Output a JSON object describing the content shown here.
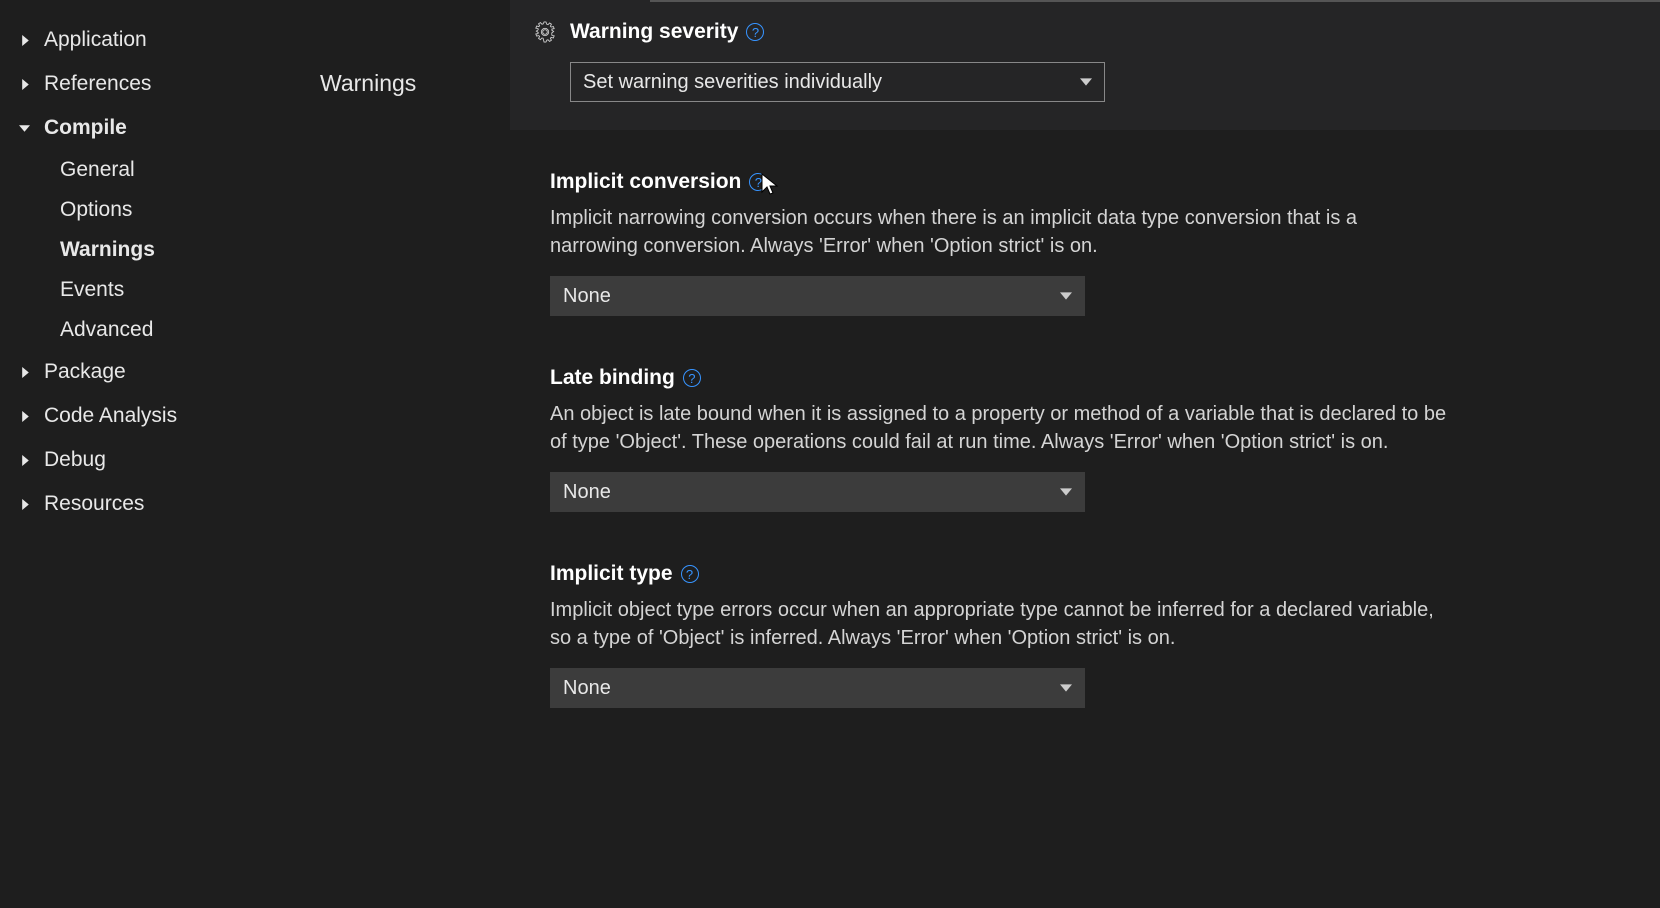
{
  "sidebar": {
    "items": [
      {
        "label": "Application",
        "expanded": false,
        "children": []
      },
      {
        "label": "References",
        "expanded": false,
        "children": []
      },
      {
        "label": "Compile",
        "expanded": true,
        "children": [
          {
            "label": "General",
            "active": false
          },
          {
            "label": "Options",
            "active": false
          },
          {
            "label": "Warnings",
            "active": true
          },
          {
            "label": "Events",
            "active": false
          },
          {
            "label": "Advanced",
            "active": false
          }
        ]
      },
      {
        "label": "Package",
        "expanded": false,
        "children": []
      },
      {
        "label": "Code Analysis",
        "expanded": false,
        "children": []
      },
      {
        "label": "Debug",
        "expanded": false,
        "children": []
      },
      {
        "label": "Resources",
        "expanded": false,
        "children": []
      }
    ]
  },
  "section": {
    "title": "Warnings"
  },
  "settings": {
    "warningSeverity": {
      "label": "Warning severity",
      "value": "Set warning severities individually"
    },
    "implicitConversion": {
      "label": "Implicit conversion",
      "description": "Implicit narrowing conversion occurs when there is an implicit data type conversion that is a narrowing conversion. Always 'Error' when 'Option strict' is on.",
      "value": "None"
    },
    "lateBinding": {
      "label": "Late binding",
      "description": "An object is late bound when it is assigned to a property or method of a variable that is declared to be of type 'Object'. These operations could fail at run time. Always 'Error' when 'Option strict' is on.",
      "value": "None"
    },
    "implicitType": {
      "label": "Implicit type",
      "description": "Implicit object type errors occur when an appropriate type cannot be inferred for a declared variable, so a type of 'Object' is inferred. Always 'Error' when 'Option strict' is on.",
      "value": "None"
    }
  }
}
